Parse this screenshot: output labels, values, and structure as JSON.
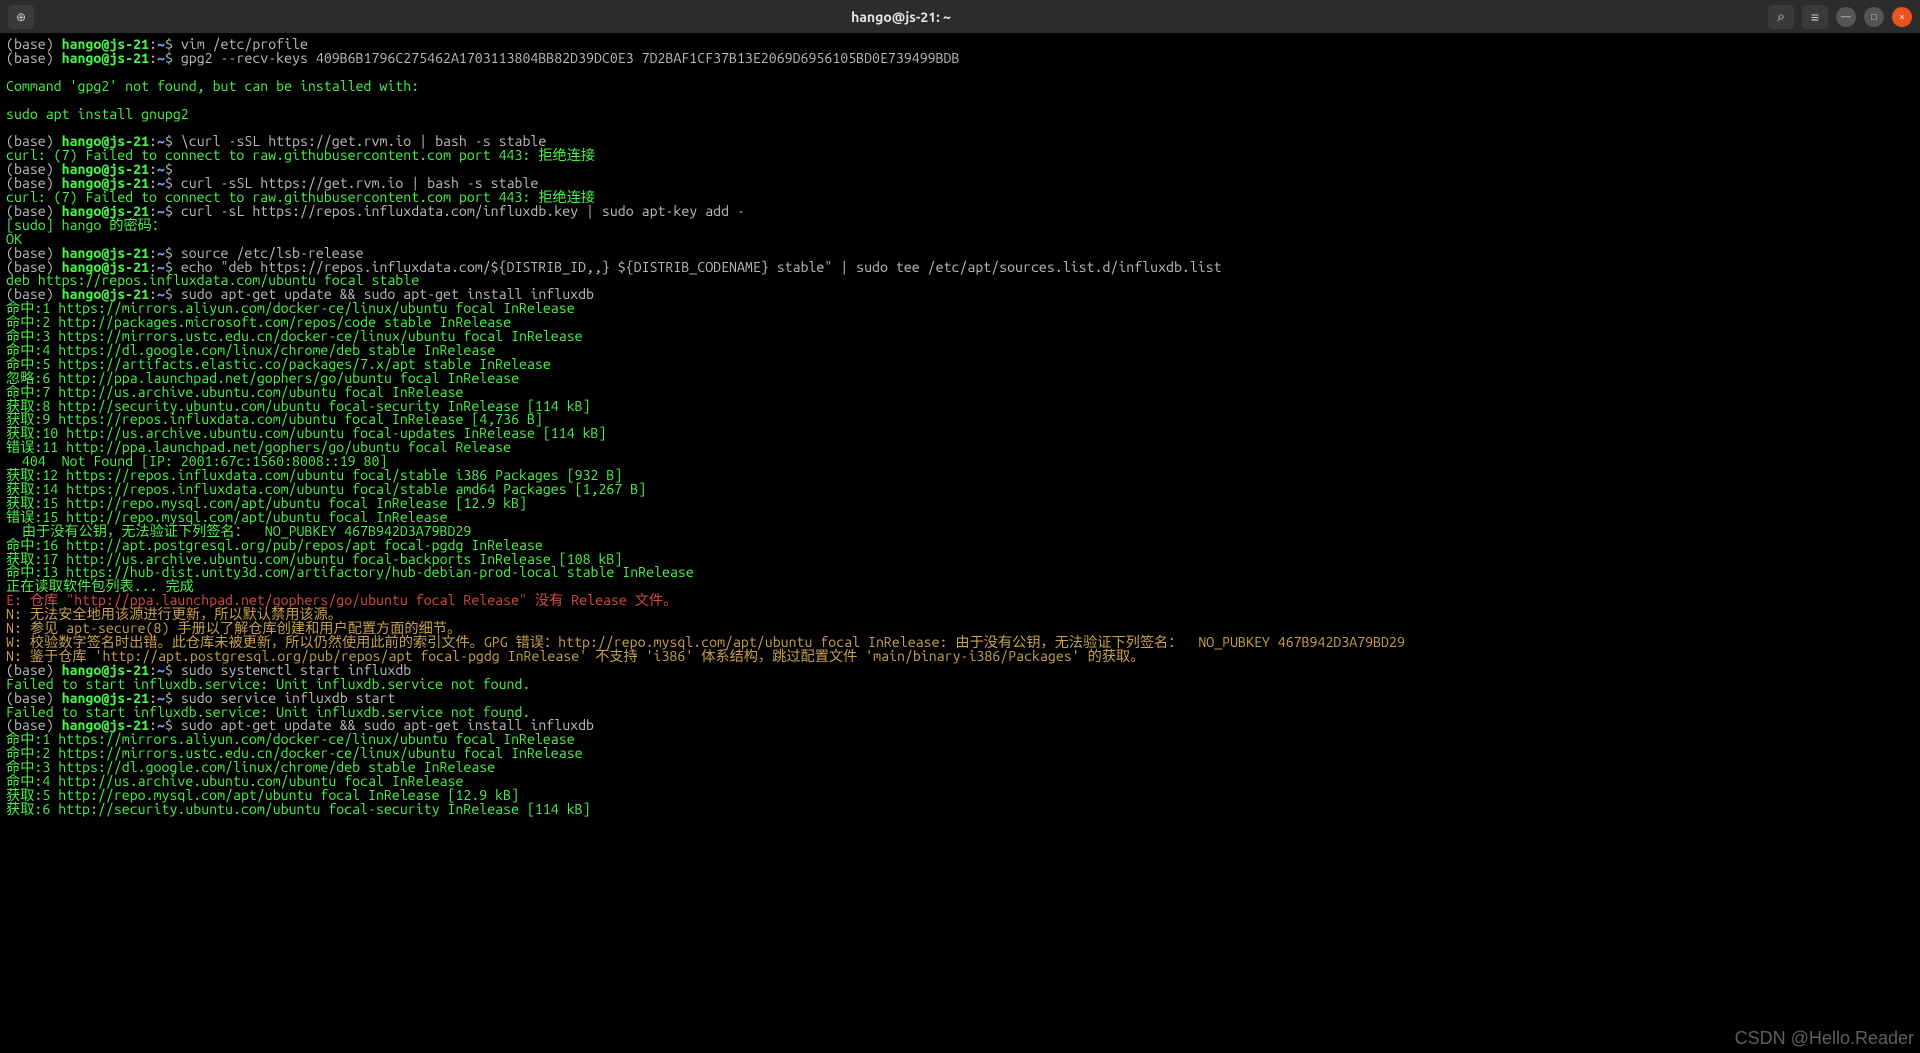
{
  "titlebar": {
    "new_tab_icon": "⊕",
    "title": "hango@js-21: ~",
    "search_icon": "⌕",
    "menu_icon": "≡",
    "min_icon": "—",
    "max_icon": "□",
    "close_icon": "×"
  },
  "prompt": {
    "base": "(base) ",
    "host": "hango@js-21",
    "colon": ":",
    "path": "~",
    "dollar": "$ "
  },
  "lines": [
    {
      "type": "cmd",
      "text": "vim /etc/profile"
    },
    {
      "type": "cmd",
      "text": "gpg2 --recv-keys 409B6B1796C275462A1703113804BB82D39DC0E3 7D2BAF1CF37B13E2069D6956105BD0E739499BDB"
    },
    {
      "type": "blank"
    },
    {
      "type": "out-green",
      "text": "Command 'gpg2' not found, but can be installed with:"
    },
    {
      "type": "blank"
    },
    {
      "type": "out-green",
      "text": "sudo apt install gnupg2"
    },
    {
      "type": "blank"
    },
    {
      "type": "cmd",
      "text": "\\curl -sSL https://get.rvm.io | bash -s stable"
    },
    {
      "type": "out-green",
      "text": "curl: (7) Failed to connect to raw.githubusercontent.com port 443: 拒绝连接"
    },
    {
      "type": "cmd",
      "text": ""
    },
    {
      "type": "cmd",
      "text": "curl -sSL https://get.rvm.io | bash -s stable"
    },
    {
      "type": "out-green",
      "text": "curl: (7) Failed to connect to raw.githubusercontent.com port 443: 拒绝连接"
    },
    {
      "type": "cmd",
      "text": "curl -sL https://repos.influxdata.com/influxdb.key | sudo apt-key add -"
    },
    {
      "type": "out-green",
      "text": "[sudo] hango 的密码："
    },
    {
      "type": "out-green",
      "text": "OK"
    },
    {
      "type": "cmd",
      "text": "source /etc/lsb-release"
    },
    {
      "type": "cmd",
      "text": "echo \"deb https://repos.influxdata.com/${DISTRIB_ID,,} ${DISTRIB_CODENAME} stable\" | sudo tee /etc/apt/sources.list.d/influxdb.list"
    },
    {
      "type": "out-green",
      "text": "deb https://repos.influxdata.com/ubuntu focal stable"
    },
    {
      "type": "cmd",
      "text": "sudo apt-get update && sudo apt-get install influxdb"
    },
    {
      "type": "out-green",
      "text": "命中:1 https://mirrors.aliyun.com/docker-ce/linux/ubuntu focal InRelease"
    },
    {
      "type": "out-green",
      "text": "命中:2 http://packages.microsoft.com/repos/code stable InRelease"
    },
    {
      "type": "out-green",
      "text": "命中:3 https://mirrors.ustc.edu.cn/docker-ce/linux/ubuntu focal InRelease"
    },
    {
      "type": "out-green",
      "text": "命中:4 https://dl.google.com/linux/chrome/deb stable InRelease"
    },
    {
      "type": "out-green",
      "text": "命中:5 https://artifacts.elastic.co/packages/7.x/apt stable InRelease"
    },
    {
      "type": "out-green",
      "text": "忽略:6 http://ppa.launchpad.net/gophers/go/ubuntu focal InRelease"
    },
    {
      "type": "out-green",
      "text": "命中:7 http://us.archive.ubuntu.com/ubuntu focal InRelease"
    },
    {
      "type": "out-green",
      "text": "获取:8 http://security.ubuntu.com/ubuntu focal-security InRelease [114 kB]"
    },
    {
      "type": "out-green",
      "text": "获取:9 https://repos.influxdata.com/ubuntu focal InRelease [4,736 B]"
    },
    {
      "type": "out-green",
      "text": "获取:10 http://us.archive.ubuntu.com/ubuntu focal-updates InRelease [114 kB]"
    },
    {
      "type": "out-green",
      "text": "错误:11 http://ppa.launchpad.net/gophers/go/ubuntu focal Release"
    },
    {
      "type": "out-green",
      "text": "  404  Not Found [IP: 2001:67c:1560:8008::19 80]"
    },
    {
      "type": "out-green",
      "text": "获取:12 https://repos.influxdata.com/ubuntu focal/stable i386 Packages [932 B]"
    },
    {
      "type": "out-green",
      "text": "获取:14 https://repos.influxdata.com/ubuntu focal/stable amd64 Packages [1,267 B]"
    },
    {
      "type": "out-green",
      "text": "获取:15 http://repo.mysql.com/apt/ubuntu focal InRelease [12.9 kB]"
    },
    {
      "type": "out-green",
      "text": "错误:15 http://repo.mysql.com/apt/ubuntu focal InRelease"
    },
    {
      "type": "out-green",
      "text": "  由于没有公钥，无法验证下列签名：  NO_PUBKEY 467B942D3A79BD29"
    },
    {
      "type": "out-green",
      "text": "命中:16 http://apt.postgresql.org/pub/repos/apt focal-pgdg InRelease"
    },
    {
      "type": "out-green",
      "text": "获取:17 http://us.archive.ubuntu.com/ubuntu focal-backports InRelease [108 kB]"
    },
    {
      "type": "out-green",
      "text": "命中:13 https://hub-dist.unity3d.com/artifactory/hub-debian-prod-local stable InRelease"
    },
    {
      "type": "out-green",
      "text": "正在读取软件包列表... 完成"
    },
    {
      "type": "out-red",
      "text": "E: 仓库 \"http://ppa.launchpad.net/gophers/go/ubuntu focal Release\" 没有 Release 文件。"
    },
    {
      "type": "out-yellow",
      "text": "N: 无法安全地用该源进行更新，所以默认禁用该源。"
    },
    {
      "type": "out-yellow",
      "text": "N: 参见 apt-secure(8) 手册以了解仓库创建和用户配置方面的细节。"
    },
    {
      "type": "out-yellow",
      "text": "W: 校验数字签名时出错。此仓库未被更新，所以仍然使用此前的索引文件。GPG 错误：http://repo.mysql.com/apt/ubuntu focal InRelease: 由于没有公钥，无法验证下列签名：  NO_PUBKEY 467B942D3A79BD29"
    },
    {
      "type": "out-yellow",
      "text": "N: 鉴于仓库 'http://apt.postgresql.org/pub/repos/apt focal-pgdg InRelease' 不支持 'i386' 体系结构，跳过配置文件 'main/binary-i386/Packages' 的获取。"
    },
    {
      "type": "cmd",
      "text": "sudo systemctl start influxdb"
    },
    {
      "type": "out-green",
      "text": "Failed to start influxdb.service: Unit influxdb.service not found."
    },
    {
      "type": "cmd",
      "text": "sudo service influxdb start"
    },
    {
      "type": "out-green",
      "text": "Failed to start influxdb.service: Unit influxdb.service not found."
    },
    {
      "type": "cmd",
      "text": "sudo apt-get update && sudo apt-get install influxdb"
    },
    {
      "type": "out-green",
      "text": "命中:1 https://mirrors.aliyun.com/docker-ce/linux/ubuntu focal InRelease"
    },
    {
      "type": "out-green",
      "text": "命中:2 https://mirrors.ustc.edu.cn/docker-ce/linux/ubuntu focal InRelease"
    },
    {
      "type": "out-green",
      "text": "命中:3 https://dl.google.com/linux/chrome/deb stable InRelease"
    },
    {
      "type": "out-green",
      "text": "命中:4 http://us.archive.ubuntu.com/ubuntu focal InRelease"
    },
    {
      "type": "out-green",
      "text": "获取:5 http://repo.mysql.com/apt/ubuntu focal InRelease [12.9 kB]"
    },
    {
      "type": "out-green",
      "text": "获取:6 http://security.ubuntu.com/ubuntu focal-security InRelease [114 kB]"
    }
  ],
  "watermark": "CSDN @Hello.Reader"
}
